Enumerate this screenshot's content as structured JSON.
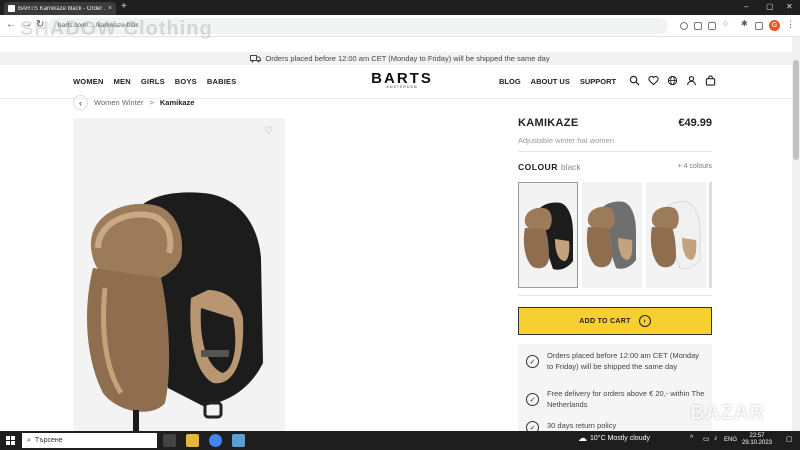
{
  "browser": {
    "tab_title": "BARTS Kamikaze black - Order ...",
    "tab_close": "×",
    "new_tab": "+",
    "url": "barts.com/... /kamikaze-blac",
    "watermark": "SHADOW Clothing"
  },
  "announcement": {
    "icon": "truck-icon",
    "text": "Orders placed before 12:00 am CET (Monday to Friday) will be shipped the same day"
  },
  "header": {
    "nav_left": [
      "WOMEN",
      "MEN",
      "GIRLS",
      "BOYS",
      "BABIES"
    ],
    "logo": "BARTS",
    "logo_sub": "AMSTERDAM",
    "nav_right": [
      "BLOG",
      "ABOUT US",
      "SUPPORT"
    ],
    "icons": [
      "search-icon",
      "heart-icon",
      "globe-icon",
      "user-icon",
      "bag-icon"
    ]
  },
  "breadcrumb": {
    "back_icon": "‹",
    "parent": "Women Winter",
    "separator": ">",
    "current": "Kamikaze"
  },
  "product": {
    "name": "KAMIKAZE",
    "price": "€49.99",
    "subtitle": "Adjustable winter hat women",
    "colour_label": "COLOUR",
    "colour_value": "black",
    "more_colours": "+ 4 colours",
    "swatches": [
      {
        "name": "black",
        "color": "#1e1e1e",
        "selected": true
      },
      {
        "name": "grey",
        "color": "#6f6f6f",
        "selected": false
      },
      {
        "name": "white",
        "color": "#f0f0f0",
        "selected": false
      }
    ],
    "add_to_cart": "ADD TO CART",
    "add_to_cart_icon": "›"
  },
  "benefits": [
    "Orders placed before 12:00 am CET (Monday to Friday) will be shipped the same day",
    "Free delivery for orders above € 20,- within The Netherlands",
    "30 days return policy"
  ],
  "overlay": {
    "brand_watermark": "BAZAR"
  },
  "taskbar": {
    "search_placeholder": "Търсене",
    "weather": "10°C  Mostly cloudy",
    "language": "ENG",
    "time": "22:57",
    "date": "29.10.2023"
  }
}
